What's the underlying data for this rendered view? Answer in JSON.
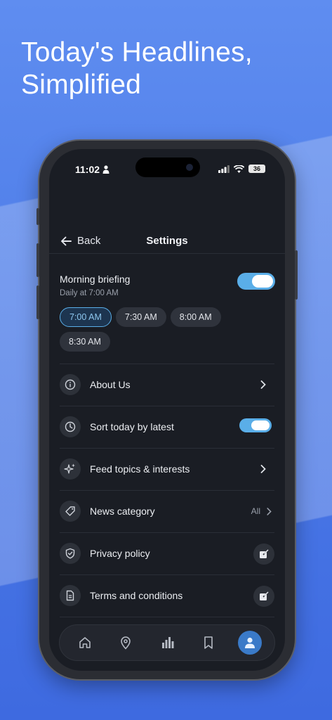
{
  "headline": "Today's Headlines, Simplified",
  "status_bar": {
    "time": "11:02",
    "battery": "36"
  },
  "nav": {
    "back_label": "Back",
    "title": "Settings"
  },
  "morning_briefing": {
    "title": "Morning briefing",
    "subtitle": "Daily at 7:00 AM",
    "enabled": true,
    "times": [
      {
        "label": "7:00 AM",
        "selected": true
      },
      {
        "label": "7:30 AM",
        "selected": false
      },
      {
        "label": "8:00 AM",
        "selected": false
      },
      {
        "label": "8:30 AM",
        "selected": false
      }
    ]
  },
  "settings": [
    {
      "icon": "info-icon",
      "label": "About Us",
      "accessory": "chevron"
    },
    {
      "icon": "clock-icon",
      "label": "Sort today by latest",
      "accessory": "toggle",
      "enabled": true
    },
    {
      "icon": "sparkles-icon",
      "label": "Feed topics & interests",
      "accessory": "chevron"
    },
    {
      "icon": "tag-icon",
      "label": "News category",
      "accessory": "value",
      "value": "All"
    },
    {
      "icon": "shield-icon",
      "label": "Privacy policy",
      "accessory": "external"
    },
    {
      "icon": "document-icon",
      "label": "Terms and conditions",
      "accessory": "external"
    }
  ],
  "tab_bar": [
    {
      "icon": "home-icon",
      "active": false
    },
    {
      "icon": "location-pin-icon",
      "active": false
    },
    {
      "icon": "bar-chart-icon",
      "active": false
    },
    {
      "icon": "bookmark-icon",
      "active": false
    },
    {
      "icon": "profile-icon",
      "active": true
    }
  ],
  "colors": {
    "background": "#4a78e4",
    "screen": "#1a1d24",
    "accent": "#5aaee8",
    "tab_active": "#3a7ac8"
  }
}
